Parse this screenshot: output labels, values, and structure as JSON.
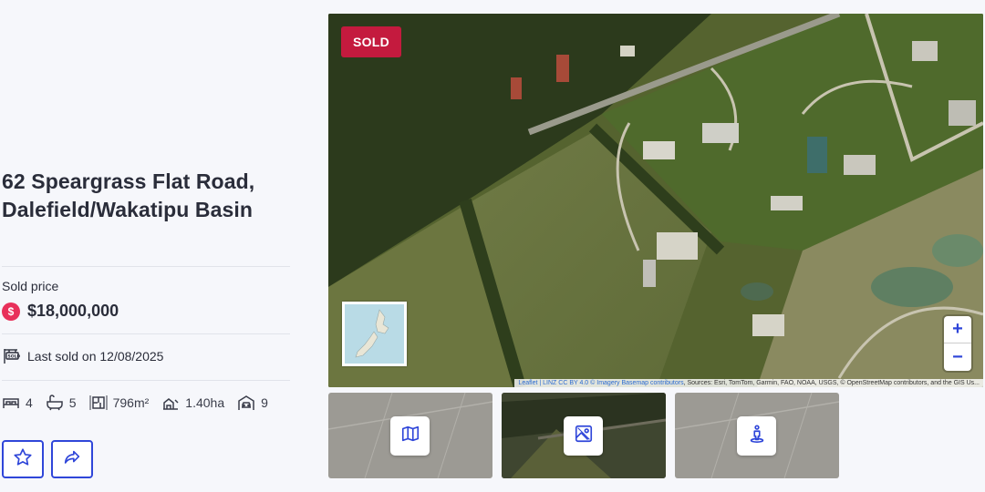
{
  "listing": {
    "title": "62 Speargrass Flat Road, Dalefield/Wakatipu Basin",
    "sold_price_label": "Sold price",
    "price": "$18,000,000",
    "price_icon_glyph": "$",
    "last_sold": "Last sold on 12/08/2025",
    "features": {
      "bedrooms": "4",
      "bathrooms": "5",
      "floor_area": "796m²",
      "land_area": "1.40ha",
      "parking": "9"
    }
  },
  "actions": {
    "favourite_icon": "star-icon",
    "share_icon": "share-arrow-icon"
  },
  "map": {
    "badge": "SOLD",
    "zoom_in": "+",
    "zoom_out": "−",
    "attribution_links": "Leaflet | LINZ CC BY 4.0 © Imagery Basemap contributors",
    "attribution_rest": ", Sources: Esri, TomTom, Garmin, FAO, NOAA, USGS, © OpenStreetMap contributors, and the GIS Us..."
  },
  "thumbnails": [
    {
      "name": "map-view",
      "icon": "map-icon"
    },
    {
      "name": "aerial-view",
      "icon": "aerial-photo-icon"
    },
    {
      "name": "street-view",
      "icon": "street-view-person-icon"
    }
  ],
  "colors": {
    "accent_blue": "#2f46d9",
    "sold_red": "#c41a3e",
    "price_pink": "#e8305a"
  }
}
